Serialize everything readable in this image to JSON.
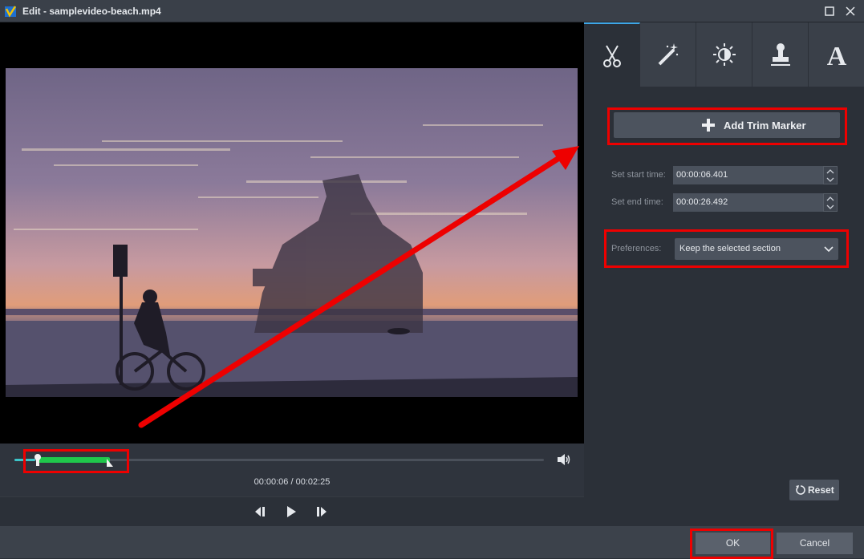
{
  "window": {
    "title": "Edit - samplevideo-beach.mp4"
  },
  "player": {
    "timecode": "00:00:06 / 00:02:25",
    "trim_start_fraction": 0.044,
    "trim_end_fraction": 0.18
  },
  "tabs": [
    {
      "icon": "scissors-icon"
    },
    {
      "icon": "magic-wand-icon"
    },
    {
      "icon": "brightness-icon"
    },
    {
      "icon": "stamp-icon"
    },
    {
      "icon": "text-icon",
      "glyph": "A"
    }
  ],
  "trim": {
    "add_label": "Add Trim Marker",
    "start_label": "Set start time:",
    "start_value": "00:00:06.401",
    "end_label": "Set end time:",
    "end_value": "00:00:26.492",
    "pref_label": "Preferences:",
    "pref_value": "Keep the selected section"
  },
  "buttons": {
    "reset": "Reset",
    "ok": "OK",
    "cancel": "Cancel"
  },
  "colors": {
    "highlight": "#e00000",
    "trim_range": "#1fc74b",
    "accent": "#3ea6e6"
  }
}
